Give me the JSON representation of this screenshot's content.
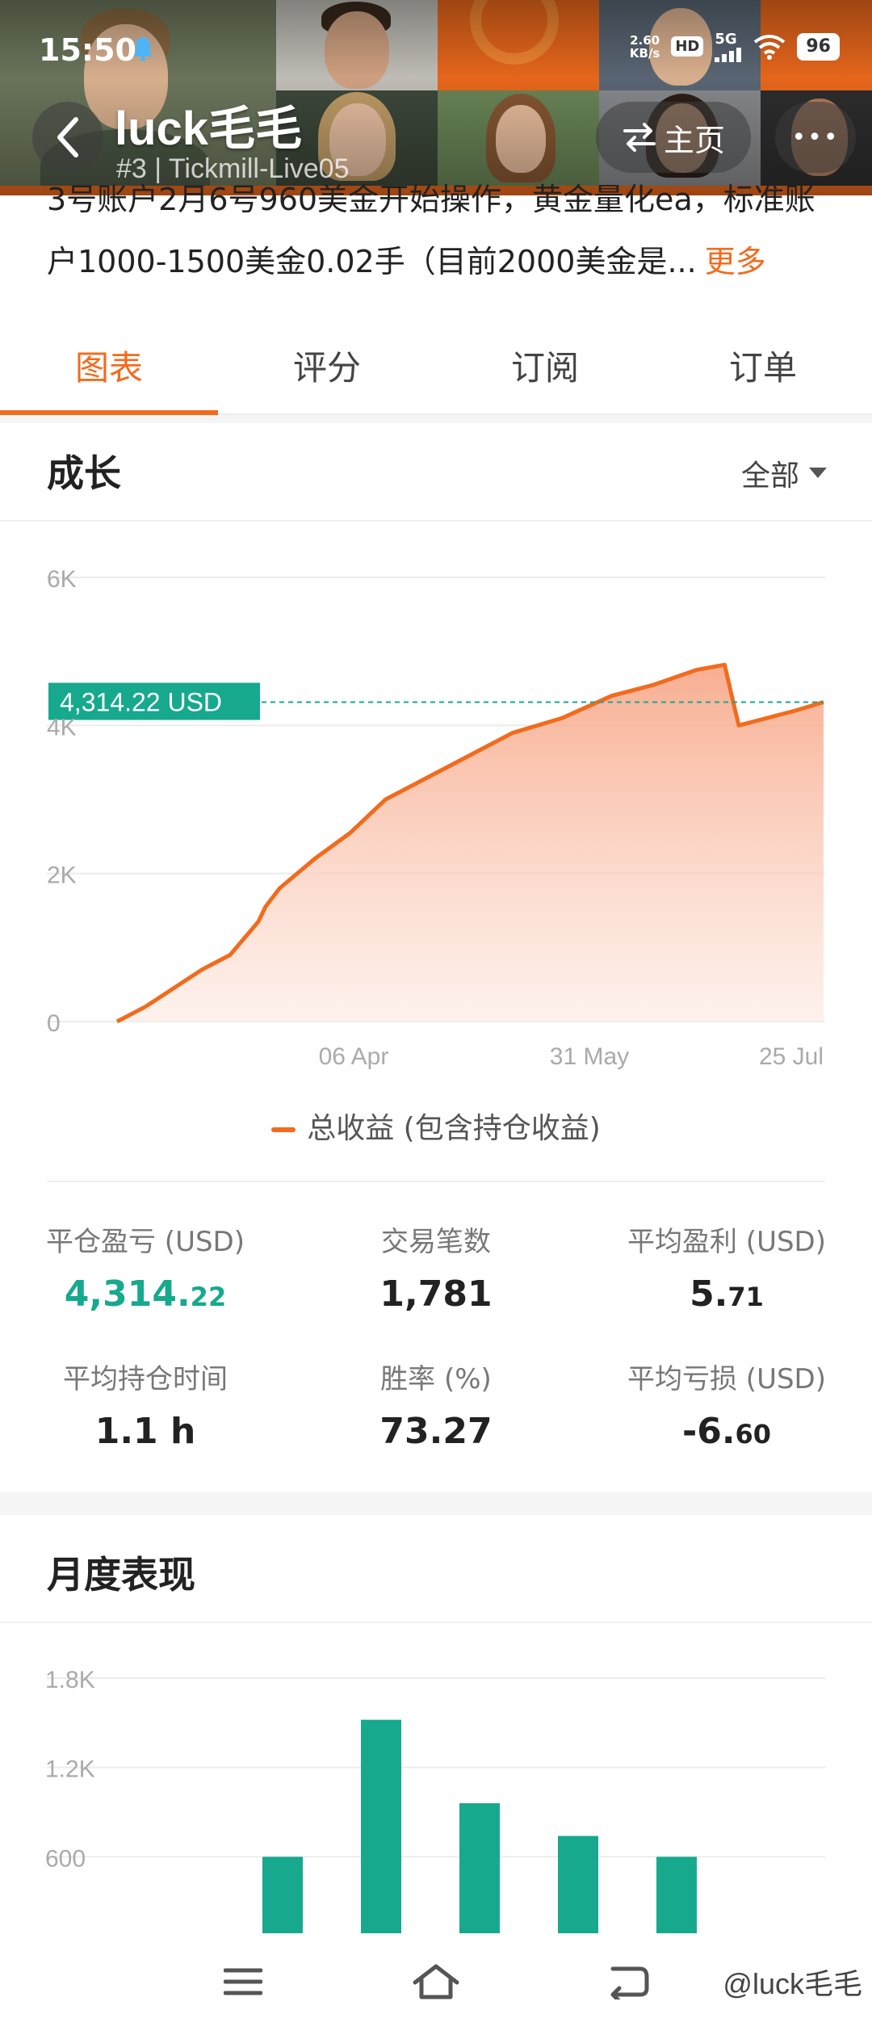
{
  "status_bar": {
    "time": "15:50",
    "net_speed_value": "2.60",
    "net_speed_unit": "KB/s",
    "hd": "HD",
    "signal": "5G",
    "battery": "96"
  },
  "header": {
    "name": "luck毛毛",
    "subtitle": "#3 | Tickmill-Live05",
    "home_label": "主页",
    "more_label": "•••"
  },
  "description": {
    "line1": "3号账户2月6号960美金开始操作，黄金量化ea，标准账",
    "line2": "户1000-1500美金0.02手（目前2000美金是...",
    "more": "更多"
  },
  "tabs": [
    {
      "label": "图表",
      "active": true
    },
    {
      "label": "评分",
      "active": false
    },
    {
      "label": "订阅",
      "active": false
    },
    {
      "label": "订单",
      "active": false
    }
  ],
  "growth": {
    "title": "成长",
    "range": "全部",
    "legend": "总收益 (包含持仓收益)",
    "current_label": "4,314.22 USD"
  },
  "chart_data": [
    {
      "type": "area",
      "title": "成长",
      "y_ticks": [
        "0",
        "2K",
        "4K",
        "6K"
      ],
      "ylim": [
        0,
        6000
      ],
      "x_ticks": [
        "06 Apr",
        "31 May",
        "25 Jul"
      ],
      "current_value": 4314.22,
      "series": [
        {
          "name": "总收益 (包含持仓收益)",
          "color": "#f26b1d",
          "x": [
            0,
            0.04,
            0.08,
            0.12,
            0.16,
            0.2,
            0.21,
            0.23,
            0.28,
            0.33,
            0.38,
            0.44,
            0.5,
            0.56,
            0.63,
            0.7,
            0.76,
            0.82,
            0.86,
            0.87,
            0.88,
            0.92,
            0.96,
            1.0
          ],
          "values": [
            0,
            200,
            450,
            700,
            900,
            1350,
            1550,
            1800,
            2200,
            2550,
            3000,
            3300,
            3600,
            3900,
            4100,
            4400,
            4550,
            4750,
            4820,
            4400,
            4000,
            4100,
            4200,
            4314.22
          ]
        }
      ]
    },
    {
      "type": "bar",
      "title": "月度表现",
      "y_ticks": [
        "600",
        "1.2K",
        "1.8K"
      ],
      "ylim": [
        0,
        1800
      ],
      "series": [
        {
          "name": "",
          "color": "#16a98d",
          "values": [
            0,
            600,
            1520,
            960,
            740,
            600
          ]
        }
      ]
    }
  ],
  "stats": [
    {
      "label": "平仓盈亏 (USD)",
      "value_main": "4,314.",
      "value_small": "22",
      "highlight": true
    },
    {
      "label": "交易笔数",
      "value_main": "1,781",
      "value_small": "",
      "highlight": false
    },
    {
      "label": "平均盈利 (USD)",
      "value_main": "5.",
      "value_small": "71",
      "highlight": false
    },
    {
      "label": "平均持仓时间",
      "value_main": "1.1 h",
      "value_small": "",
      "highlight": false
    },
    {
      "label": "胜率 (%)",
      "value_main": "73.27",
      "value_small": "",
      "highlight": false
    },
    {
      "label": "平均亏损 (USD)",
      "value_main": "-6.",
      "value_small": "60",
      "highlight": false
    }
  ],
  "monthly": {
    "title": "月度表现"
  },
  "nav": {
    "watermark": "@luck毛毛"
  },
  "colors": {
    "accent": "#f26b1d",
    "green": "#16a98d",
    "fill": "#fbd3c0"
  }
}
